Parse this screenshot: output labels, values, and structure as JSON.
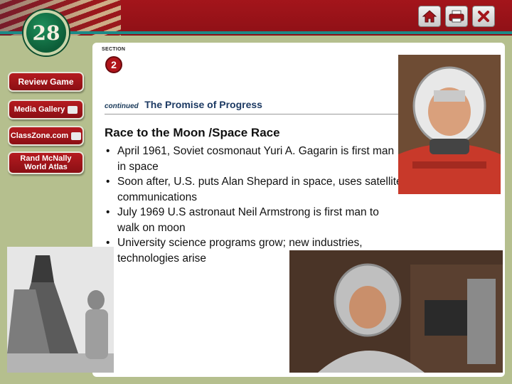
{
  "chapter": {
    "number": "28"
  },
  "nav": {
    "home_icon": "home-icon",
    "print_icon": "printer-icon",
    "close_icon": "close-icon"
  },
  "sidebar": {
    "items": [
      {
        "label": "Review Game"
      },
      {
        "label": "Media Gallery"
      },
      {
        "label": "ClassZone.com"
      },
      {
        "label_line1": "Rand McNally",
        "label_line2": "World Atlas"
      }
    ]
  },
  "section": {
    "label": "SECTION",
    "number": "2"
  },
  "header": {
    "continued": "continued",
    "subtitle": "The Promise of Progress"
  },
  "main": {
    "title": "Race to the Moon /Space Race",
    "bullets": [
      "April 1961, Soviet cosmonaut Yuri A. Gagarin is first man in space",
      "Soon after, U.S. puts Alan Shepard  in space, uses satellite communications",
      " July 1969 U.S astronaut Neil Armstrong is first man to walk on moon",
      "University science programs grow; new industries, technologies arise"
    ]
  },
  "colors": {
    "button_red": "#a3151b",
    "banner_teal": "#1d8a86",
    "background_olive": "#b5bf8e",
    "subtitle_blue": "#1d3a63"
  }
}
